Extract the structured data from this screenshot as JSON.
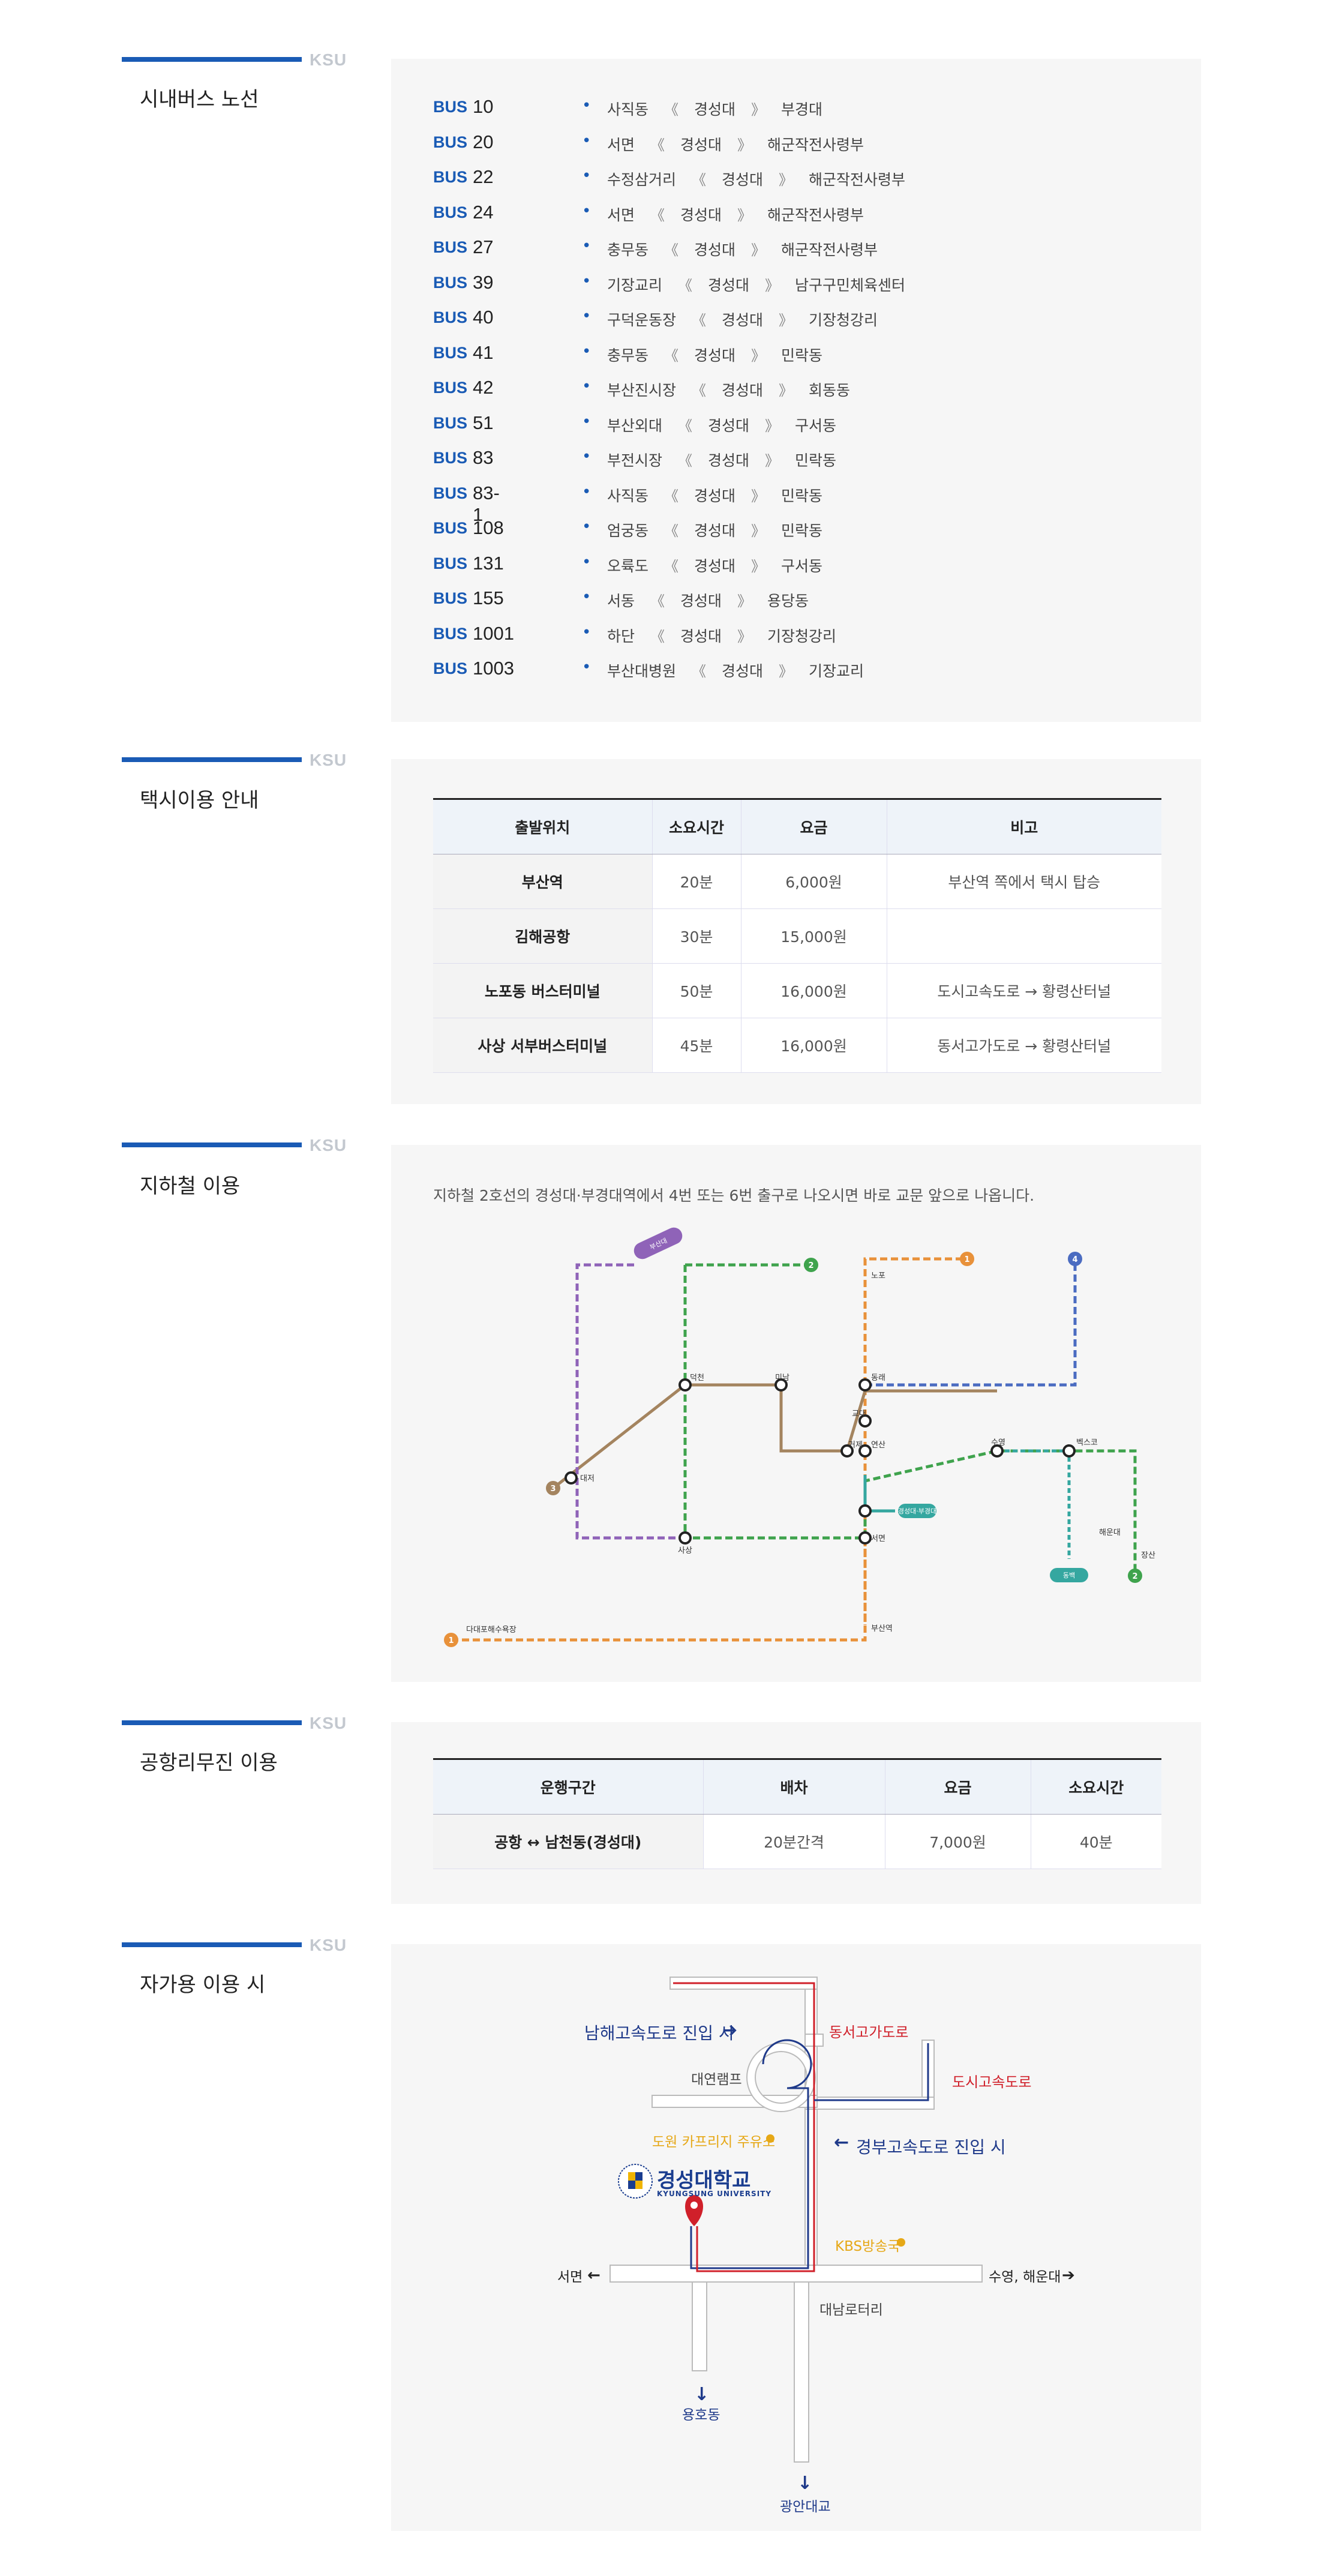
{
  "ksu": "KSU",
  "sections": {
    "bus": "시내버스 노선",
    "taxi": "택시이용 안내",
    "subway": "지하철 이용",
    "limousine": "공항리무진 이용",
    "car": "자가용 이용 시"
  },
  "bus_label": "BUS",
  "arrow_left": "《",
  "arrow_right": "》",
  "bus_routes": [
    {
      "no": "10",
      "from": "사직동",
      "via": "경성대",
      "to": "부경대"
    },
    {
      "no": "20",
      "from": "서면",
      "via": "경성대",
      "to": "해군작전사령부"
    },
    {
      "no": "22",
      "from": "수정삼거리",
      "via": "경성대",
      "to": "해군작전사령부"
    },
    {
      "no": "24",
      "from": "서면",
      "via": "경성대",
      "to": "해군작전사령부"
    },
    {
      "no": "27",
      "from": "충무동",
      "via": "경성대",
      "to": "해군작전사령부"
    },
    {
      "no": "39",
      "from": "기장교리",
      "via": "경성대",
      "to": "남구구민체육센터"
    },
    {
      "no": "40",
      "from": "구덕운동장",
      "via": "경성대",
      "to": "기장청강리"
    },
    {
      "no": "41",
      "from": "충무동",
      "via": "경성대",
      "to": "민락동"
    },
    {
      "no": "42",
      "from": "부산진시장",
      "via": "경성대",
      "to": "회동동"
    },
    {
      "no": "51",
      "from": "부산외대",
      "via": "경성대",
      "to": "구서동"
    },
    {
      "no": "83",
      "from": "부전시장",
      "via": "경성대",
      "to": "민락동"
    },
    {
      "no": "83-1",
      "from": "사직동",
      "via": "경성대",
      "to": "민락동"
    },
    {
      "no": "108",
      "from": "엄궁동",
      "via": "경성대",
      "to": "민락동"
    },
    {
      "no": "131",
      "from": "오륙도",
      "via": "경성대",
      "to": "구서동"
    },
    {
      "no": "155",
      "from": "서동",
      "via": "경성대",
      "to": "용당동"
    },
    {
      "no": "1001",
      "from": "하단",
      "via": "경성대",
      "to": "기장청강리"
    },
    {
      "no": "1003",
      "from": "부산대병원",
      "via": "경성대",
      "to": "기장교리"
    }
  ],
  "taxi": {
    "headers": [
      "출발위치",
      "소요시간",
      "요금",
      "비고"
    ],
    "rows": [
      [
        "부산역",
        "20분",
        "6,000원",
        "부산역 쪽에서 택시 탑승"
      ],
      [
        "김해공항",
        "30분",
        "15,000원",
        ""
      ],
      [
        "노포동 버스터미널",
        "50분",
        "16,000원",
        "도시고속도로 → 황령산터널"
      ],
      [
        "사상 서부버스터미널",
        "45분",
        "16,000원",
        "동서고가도로 → 황령산터널"
      ]
    ]
  },
  "subway": {
    "desc": "지하철 2호선의 경성대·부경대역에서 4번 또는 6번 출구로 나오시면 바로 교문 앞으로 나옵니다.",
    "stations": {
      "seomyeon": "서면",
      "yeonsan": "연산",
      "dongnae": "동래",
      "deokcheon": "덕천",
      "minam": "미남",
      "sasang": "사상",
      "daejeo": "대저",
      "suyeong": "수영",
      "bexco": "벡스코",
      "geoje": "거제",
      "gyodae": "교대",
      "busan_univ": "부산대",
      "busan_station": "부산역",
      "daeti": "대티",
      "nopo": "노포",
      "jangsan": "장산",
      "dadaepo": "다대포해수욕장",
      "kyungsung": "경성대·부경대",
      "busanjin": "부산진",
      "dongbaek": "동백",
      "haeundae": "해운대"
    },
    "line_numbers": [
      "1",
      "2",
      "3",
      "4"
    ]
  },
  "limousine": {
    "headers": [
      "운행구간",
      "배차",
      "요금",
      "소요시간"
    ],
    "rows": [
      [
        "공항 ↔ 남천동(경성대)",
        "20분간격",
        "7,000원",
        "40분"
      ]
    ]
  },
  "car": {
    "namhae": "남해고속도로 진입 시",
    "donggo": "동서고가도로",
    "daeyeon_ramp": "대연램프",
    "dosi": "도시고속도로",
    "gasstation": "도원 카프리지 주유소",
    "gyeongbu": "경부고속도로 진입 시",
    "univ_ko": "경성대학교",
    "univ_en": "KYUNGSUNG UNIVERSITY",
    "kbs": "KBS방송국",
    "seomyeon": "서면",
    "suyeong": "수영, 해운대",
    "daenam": "대남로터리",
    "yongho": "용호동",
    "gwangan": "광안대교"
  },
  "colors": {
    "accent": "#1a5bb5",
    "line1": "#e8913a",
    "line2": "#3fa34d",
    "line3": "#a4845f",
    "line4": "#4b6cc1",
    "busan_kimhae": "#8f63b8",
    "donghae": "#35a7a0",
    "red_route": "#d0202a",
    "gold": "#e6a817"
  }
}
